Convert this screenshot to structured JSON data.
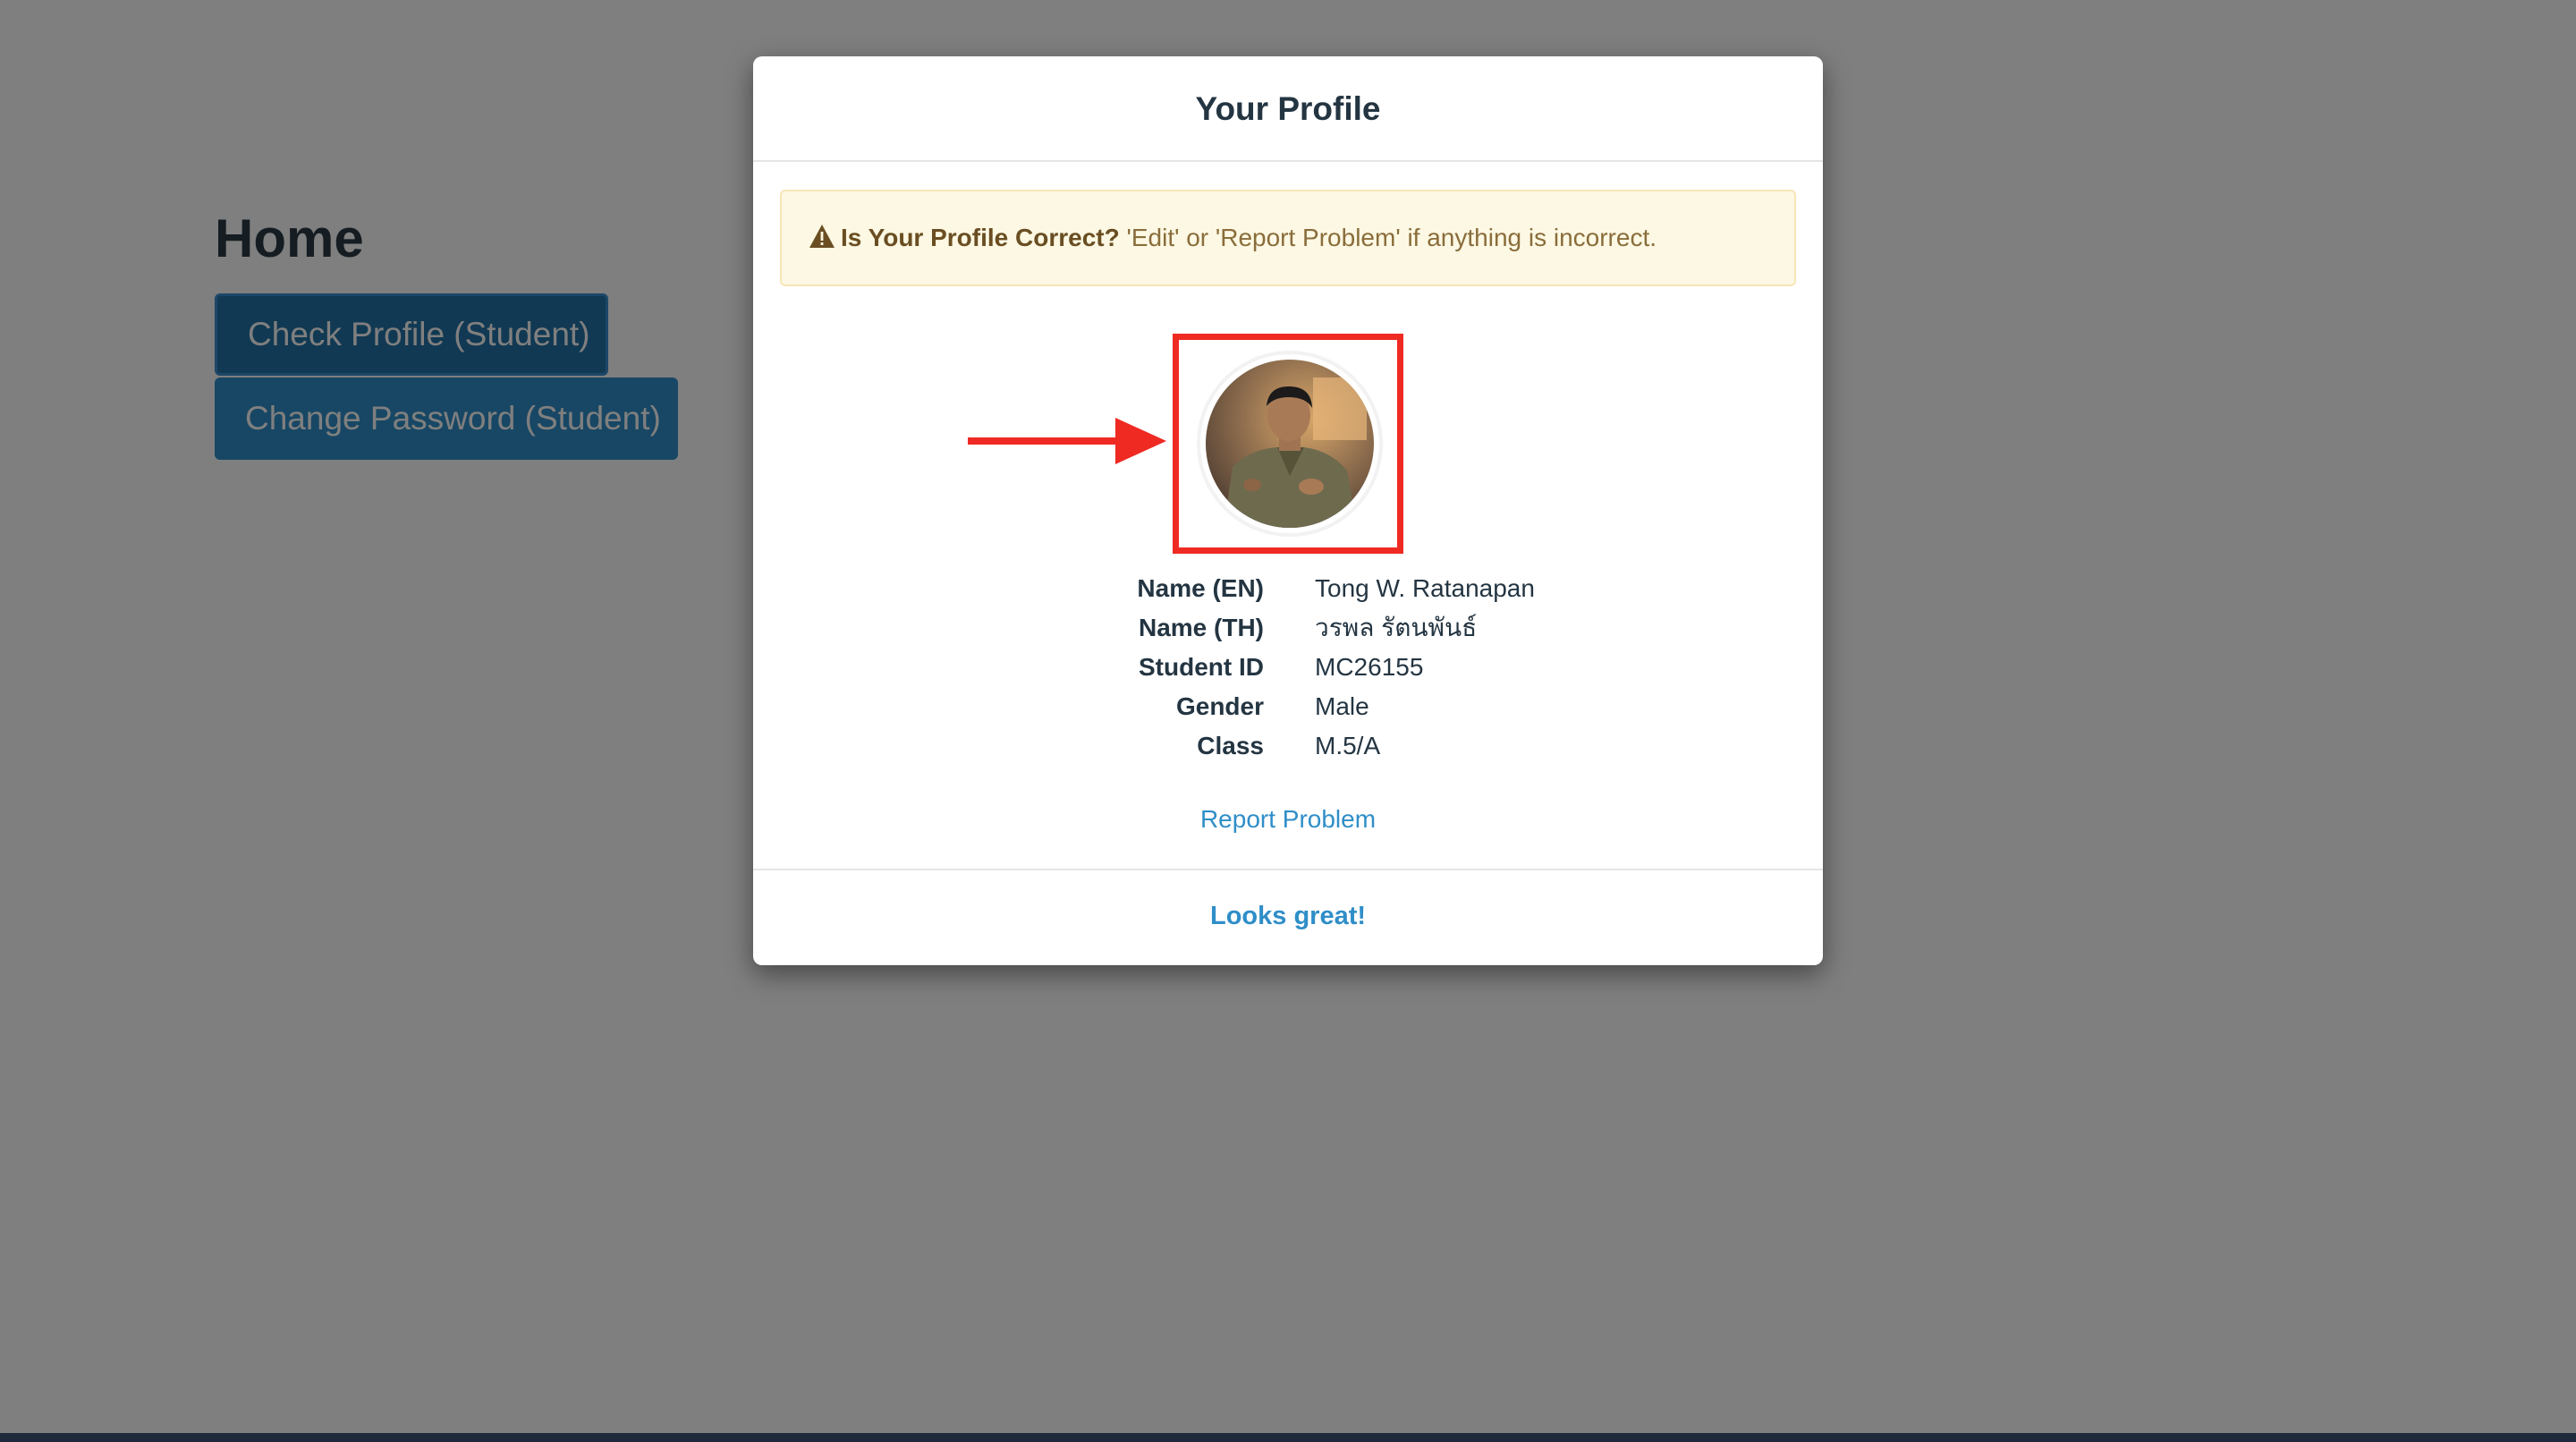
{
  "page": {
    "title": "Home",
    "buttons": {
      "check_profile": "Check Profile (Student)",
      "change_password": "Change Password (Student)"
    }
  },
  "modal": {
    "title": "Your Profile",
    "alert": {
      "icon": "warning-triangle-icon",
      "strong": "Is Your Profile Correct?",
      "text": " 'Edit' or 'Report Problem' if anything is incorrect."
    },
    "avatar": {
      "icon": "profile-photo"
    },
    "profile": [
      {
        "label": "Name (EN)",
        "value": "Tong W. Ratanapan"
      },
      {
        "label": "Name (TH)",
        "value": "วรพล รัตนพันธ์"
      },
      {
        "label": "Student ID",
        "value": "MC26155"
      },
      {
        "label": "Gender",
        "value": "Male"
      },
      {
        "label": "Class",
        "value": "M.5/A"
      }
    ],
    "report_link": "Report Problem",
    "confirm_button": "Looks great!"
  },
  "colors": {
    "primary": "#2f8ec8",
    "highlight": "#ee2a23",
    "alert_bg": "#fcf8e3",
    "alert_text": "#8a6d3b"
  }
}
